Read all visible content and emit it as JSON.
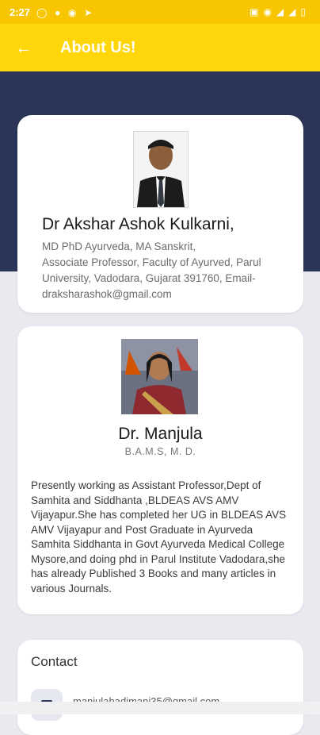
{
  "status_bar": {
    "time": "2:27",
    "left_icons": [
      "whatsapp-icon",
      "messenger-icon",
      "app-icon",
      "telegram-icon"
    ],
    "right_icons": [
      "volte-icon",
      "wifi-icon",
      "signal-icon",
      "signal-icon",
      "battery-icon"
    ]
  },
  "app_bar": {
    "title": "About Us!",
    "back_icon": "arrow-left-icon"
  },
  "colors": {
    "app_bar": "#ffd60a",
    "status_bar": "#f7c600",
    "header_band": "#2a3558",
    "background": "#e9eaf0"
  },
  "profiles": [
    {
      "name": "Dr Akshar Ashok Kulkarni,",
      "details": "MD PhD Ayurveda, MA Sanskrit,\nAssociate Professor, Faculty of Ayurved, Parul University, Vadodara, Gujarat 391760, Email- draksharashok@gmail.com"
    },
    {
      "name": "Dr. Manjula",
      "qualification": "B.A.M.S, M. D.",
      "bio": "Presently working as Assistant Professor,Dept of Samhita and Siddhanta ,BLDEAS AVS AMV Vijayapur.She has completed her UG in BLDEAS AVS AMV Vijayapur and Post Graduate in Ayurveda Samhita Siddhanta in Govt Ayurveda Medical College Mysore,and doing phd in Parul Institute Vadodara,she has already Published 3 Books and many articles in various Journals."
    }
  ],
  "contact": {
    "title": "Contact",
    "item_icon": "email-icon",
    "item_text": "manjulahadimani35@gmail.com"
  }
}
